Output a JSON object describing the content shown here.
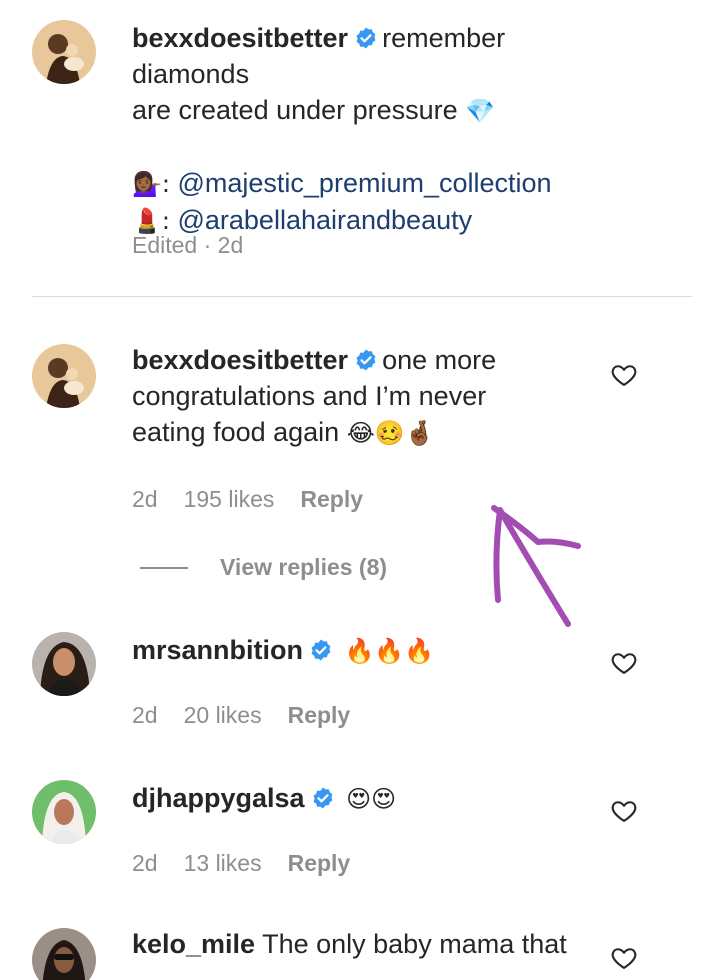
{
  "caption": {
    "username": "bexxdoesitbetter",
    "text_line1": "remember diamonds",
    "text_line2": "are created under pressure",
    "line2_emoji": "💎",
    "credit1_emoji": "💁🏾‍♀️:",
    "credit1_handle": "@majestic_premium_collection",
    "credit2_emoji": "💄:",
    "credit2_handle": "@arabellahairandbeauty",
    "edited": "Edited · 2d"
  },
  "comments": [
    {
      "username": "bexxdoesitbetter",
      "line1": "one more",
      "line2": "congratulations and I’m never",
      "line3": "eating food again",
      "emojis": "😂🥴🤞🏾",
      "time": "2d",
      "likes": "195 likes",
      "reply": "Reply"
    },
    {
      "username": "mrsannbition",
      "emojis": "🔥🔥🔥",
      "time": "2d",
      "likes": "20 likes",
      "reply": "Reply"
    },
    {
      "username": "djhappygalsa",
      "emojis": "😍😍",
      "time": "2d",
      "likes": "13 likes",
      "reply": "Reply"
    },
    {
      "username": "kelo_mile",
      "text": "The only baby mama that"
    }
  ],
  "view_replies": "View replies (8)",
  "colors": {
    "text": "#262626",
    "muted": "#8e8e8e",
    "mention": "#1d3e6e",
    "verified": "#3897f0",
    "annotation_arrow": "#a34db3"
  }
}
